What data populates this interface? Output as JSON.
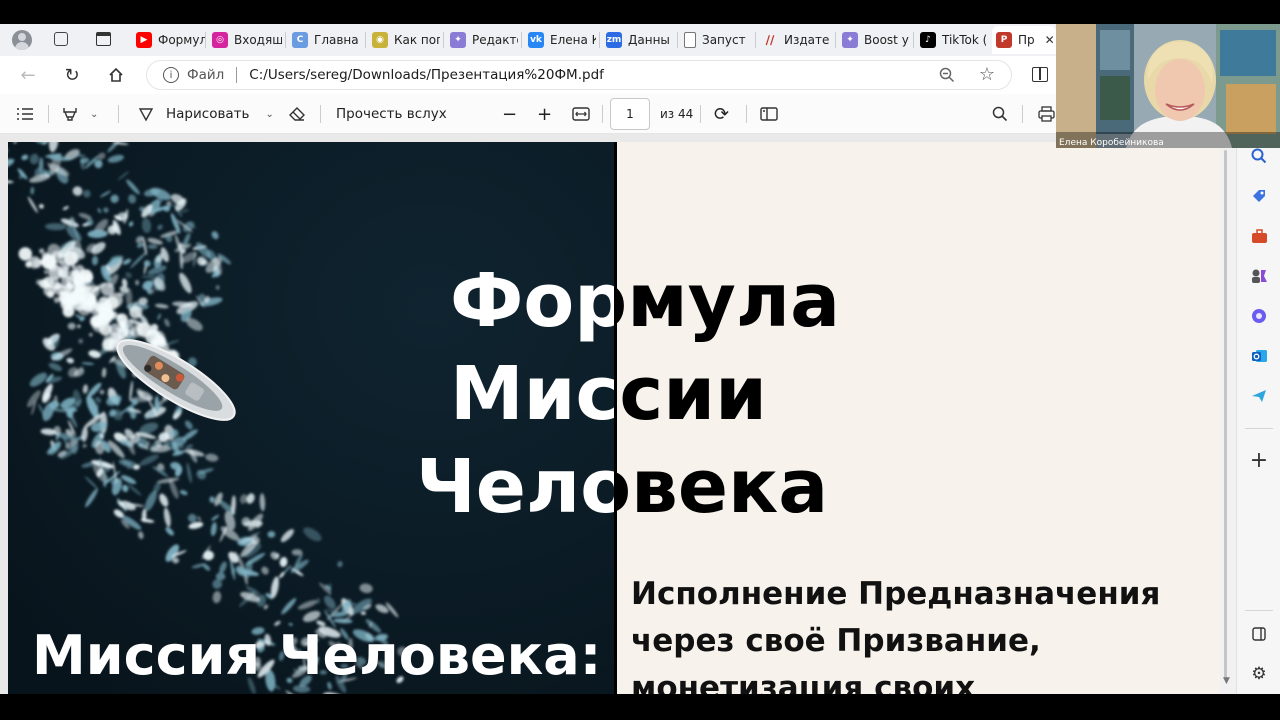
{
  "tabs": [
    {
      "label": "Формул",
      "icon": "youtube-icon",
      "color": "#ff0000"
    },
    {
      "label": "Входящ",
      "icon": "instagram-icon",
      "color": "#d6249f"
    },
    {
      "label": "Главна",
      "icon": "c-icon",
      "color": "#6b9be0"
    },
    {
      "label": "Как пог",
      "icon": "chrome-like-icon",
      "color": "#c9b23a"
    },
    {
      "label": "Редакто",
      "icon": "copilot-icon",
      "color": "#8a7bd6"
    },
    {
      "label": "Елена К",
      "icon": "vk-icon",
      "color": "#2787f5"
    },
    {
      "label": "Данны",
      "icon": "zm-icon",
      "color": "#2d6be4"
    },
    {
      "label": "Запуст",
      "icon": "page-icon",
      "color": "#777777"
    },
    {
      "label": "Издате",
      "icon": "stripes-icon",
      "color": "#c0392b"
    },
    {
      "label": "Boost y",
      "icon": "boost-icon",
      "color": "#8a7bd6"
    },
    {
      "label": "TikTok (",
      "icon": "tiktok-icon",
      "color": "#000000"
    },
    {
      "label": "Пр",
      "icon": "pdf-icon",
      "color": "#c0392b"
    }
  ],
  "address": {
    "file_label": "Файл",
    "url": "C:/Users/sereg/Downloads/Презентация%20ФМ.pdf"
  },
  "pdf_toolbar": {
    "draw_label": "Нарисовать",
    "read_aloud_label": "Прочесть вслух",
    "page_value": "1",
    "page_total": "из 44"
  },
  "slide": {
    "title_lines": [
      "Формула",
      "Миссии",
      "Человека"
    ],
    "left_caption": "Миссия Человека:",
    "right_text_lines": [
      "Исполнение Предназначения",
      "через своё Призвание,",
      "монетизация своих"
    ]
  },
  "video": {
    "name": "Елена Коробейникова"
  },
  "colors": {
    "ocean_dark": "#0c1c26",
    "foam": "#e8f4f8",
    "slide_bg": "#f7f2ec"
  }
}
